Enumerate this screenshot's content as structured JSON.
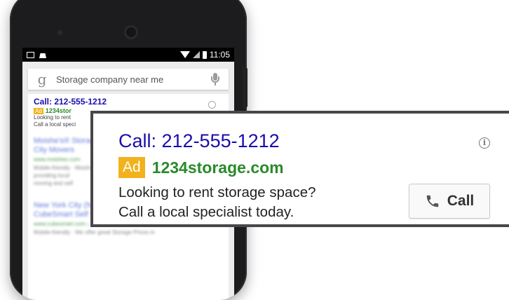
{
  "status_bar": {
    "time": "11:05"
  },
  "search": {
    "query": "Storage company near me",
    "logo": "g"
  },
  "small_ad": {
    "title": "Call: 212-555-1212",
    "badge": "Ad",
    "url": "1234stor",
    "line1": "Looking to rent",
    "line2": "Call a local speci"
  },
  "blurred_results": [
    {
      "title": "Moishe's® Storage | New York",
      "title2": "City Movers",
      "url": "www.moishes.com",
      "desc1": "Mobile-friendly · Moishe's",
      "desc2": "providing local",
      "desc3": "moving and self"
    },
    {
      "title": "New York City (NYC), NY Storage Units |",
      "title2": "CubeSmart Self Storage",
      "url": "www.cubesmart.com › ... › New York",
      "desc1": "Mobile-friendly · We offer great Storage Prices in"
    }
  ],
  "ad": {
    "title": "Call: 212-555-1212",
    "badge": "Ad",
    "url": "1234storage.com",
    "line1": "Looking to rent storage space?",
    "line2": "Call a local specialist today.",
    "call_label": "Call",
    "info_glyph": "i"
  },
  "colors": {
    "link_blue": "#1a0dab",
    "url_green": "#2a8a2a",
    "ad_badge": "#f1b21c"
  }
}
